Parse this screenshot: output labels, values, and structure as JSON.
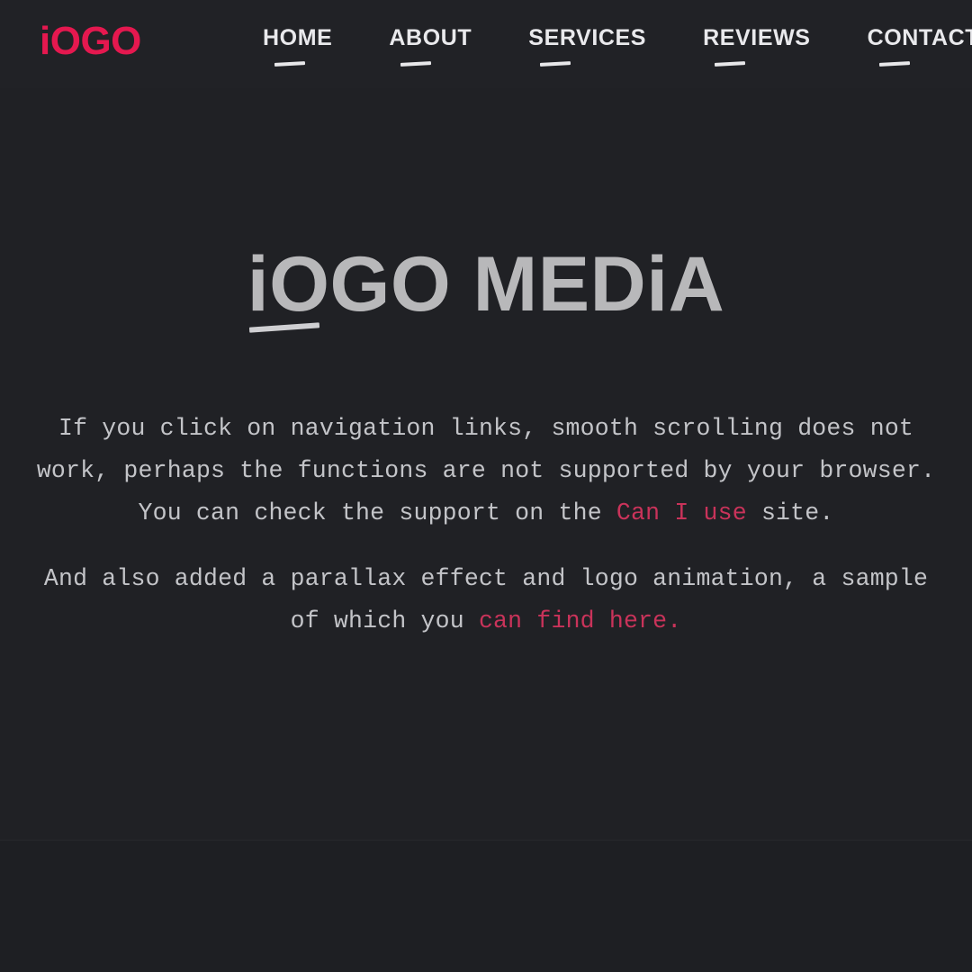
{
  "site": {
    "background_color": "#1f2024",
    "accent_color": "#e5184f",
    "link_color": "#c9335a",
    "text_color": "#c3c4c8",
    "heading_color": "#b8b8ba"
  },
  "header": {
    "brand": "iOGO",
    "nav": [
      {
        "label": "HOME"
      },
      {
        "label": "ABOUT"
      },
      {
        "label": "SERVICES"
      },
      {
        "label": "REVIEWS"
      },
      {
        "label": "CONTACT"
      }
    ]
  },
  "hero": {
    "title": "iOGO MEDiA",
    "paragraph_1": {
      "before_link": "If you click on navigation links, smooth scrolling does not work, perhaps the functions are not supported by your browser. You can check the support on the ",
      "link": "Can I use",
      "after_link": " site."
    },
    "paragraph_2": {
      "before_link": "And also added a parallax effect and logo animation, a sample of which you ",
      "link": "can find here.",
      "after_link": ""
    }
  }
}
